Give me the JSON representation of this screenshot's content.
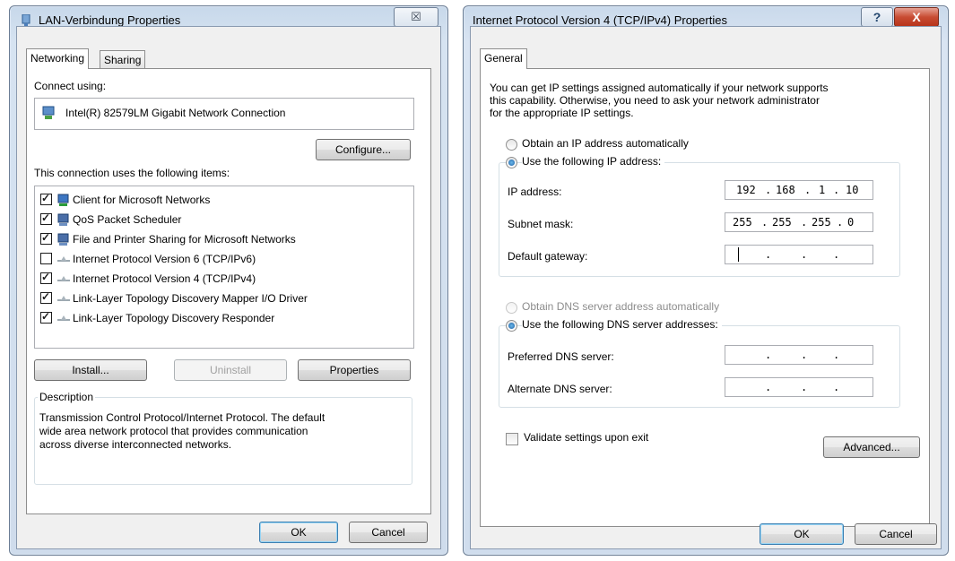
{
  "lan": {
    "title": "LAN-Verbindung Properties",
    "close_glyph": "☒",
    "tabs": [
      "Networking",
      "Sharing"
    ],
    "connect_using_label": "Connect using:",
    "adapter_name": "Intel(R) 82579LM Gigabit Network Connection",
    "configure_label": "Configure...",
    "items_label": "This connection uses the following items:",
    "items": [
      {
        "label": "Client for Microsoft Networks",
        "checked": true,
        "icon": "network-client-icon"
      },
      {
        "label": "QoS Packet Scheduler",
        "checked": true,
        "icon": "service-icon"
      },
      {
        "label": "File and Printer Sharing for Microsoft Networks",
        "checked": true,
        "icon": "service-icon"
      },
      {
        "label": "Internet Protocol Version 6 (TCP/IPv6)",
        "checked": false,
        "icon": "protocol-icon"
      },
      {
        "label": "Internet Protocol Version 4 (TCP/IPv4)",
        "checked": true,
        "icon": "protocol-icon"
      },
      {
        "label": "Link-Layer Topology Discovery Mapper I/O Driver",
        "checked": true,
        "icon": "protocol-icon"
      },
      {
        "label": "Link-Layer Topology Discovery Responder",
        "checked": true,
        "icon": "protocol-icon"
      }
    ],
    "install_label": "Install...",
    "uninstall_label": "Uninstall",
    "properties_label": "Properties",
    "description_label": "Description",
    "description_line1": "Transmission Control Protocol/Internet Protocol. The default",
    "description_line2": "wide area network protocol that provides communication",
    "description_line3": "across diverse interconnected networks.",
    "ok_label": "OK",
    "cancel_label": "Cancel"
  },
  "ipv4": {
    "title": "Internet Protocol Version 4 (TCP/IPv4) Properties",
    "help_glyph": "?",
    "close_glyph": "X",
    "tab": "General",
    "intro_line1": "You can get IP settings assigned automatically if your network supports",
    "intro_line2": "this capability. Otherwise, you need to ask your network administrator",
    "intro_line3": "for the appropriate IP settings.",
    "obtain_ip_label": "Obtain an IP address automatically",
    "use_ip_label": "Use the following IP address:",
    "ip_address_label": "IP address:",
    "ip_address": [
      "192",
      "168",
      "1",
      "10"
    ],
    "subnet_label": "Subnet mask:",
    "subnet": [
      "255",
      "255",
      "255",
      "0"
    ],
    "gateway_label": "Default gateway:",
    "obtain_dns_label": "Obtain DNS server address automatically",
    "use_dns_label": "Use the following DNS server addresses:",
    "preferred_dns_label": "Preferred DNS server:",
    "alternate_dns_label": "Alternate DNS server:",
    "validate_label": "Validate settings upon exit",
    "advanced_label": "Advanced...",
    "ok_label": "OK",
    "cancel_label": "Cancel",
    "selected_ip_mode": "manual",
    "selected_dns_mode": "manual"
  }
}
